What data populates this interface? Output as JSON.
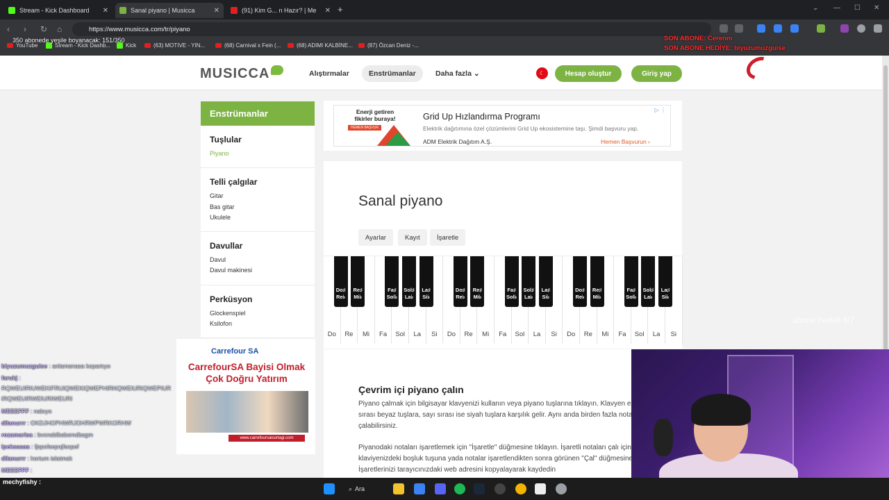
{
  "tabs": [
    {
      "title": "Stream - Kick Dashboard",
      "color": "#53fc18"
    },
    {
      "title": "Sanal piyano | Musicca",
      "color": "#7cb342"
    },
    {
      "title": "(91) Kim G... n Hazır? | Me",
      "color": "#e02020"
    }
  ],
  "address": {
    "url": "https://www.musicca.com/tr/piyano"
  },
  "bookmarks": [
    "YouTube",
    "Stream - Kick Dashb...",
    "Kick",
    "(63) MOTIVE - YIN...",
    "(68) Carnival x Fein (...",
    "(68) ADIMI KALBİNE...",
    "(87) Özcan Deniz -..."
  ],
  "overlay": {
    "subs": "350 abonede yeşile boyanacak: 151/350",
    "last_sub": "SON ABONE: Cerenm",
    "last_gift": "SON ABONE HEDİYE: biyuzumuzguise",
    "goal": "abone hedefi 6/7"
  },
  "site": {
    "logo": "MUSICCA",
    "nav": [
      "Alıştırmalar",
      "Enstrümanlar",
      "Daha fazla"
    ],
    "signup": "Hesap oluştur",
    "login": "Giriş yap"
  },
  "sidebar": {
    "title": "Enstrümanlar",
    "sections": [
      {
        "heading": "Tuşlular",
        "items": [
          "Piyano"
        ]
      },
      {
        "heading": "Telli çalgılar",
        "items": [
          "Gitar",
          "Bas gitar",
          "Ukulele"
        ]
      },
      {
        "heading": "Davullar",
        "items": [
          "Davul",
          "Davul makinesi"
        ]
      },
      {
        "heading": "Perküsyon",
        "items": [
          "Glockenspiel",
          "Ksilofon"
        ]
      }
    ]
  },
  "ad": {
    "img_text": "Enerji getiren fikirler buraya!",
    "img_button": "HEMEN BAŞVUR",
    "title": "Grid Up Hızlandırma Programı",
    "desc": "Elektrik dağıtımına özel çözümlerini Grid Up ekosistemine taşı. Şimdi başvuru yap.",
    "advertiser": "ADM Elektrik Dağıtım A.Ş.",
    "cta": "Hemen Başvurun ›"
  },
  "main": {
    "title": "Sanal piyano",
    "tools": [
      "Ayarlar",
      "Kayıt",
      "İşaretle"
    ],
    "white_keys": [
      "Do",
      "Re",
      "Mi",
      "Fa",
      "Sol",
      "La",
      "Si",
      "Do",
      "Re",
      "Mi",
      "Fa",
      "Sol",
      "La",
      "Si",
      "Do",
      "Re",
      "Mi",
      "Fa",
      "Sol",
      "La",
      "Si"
    ],
    "black_keys": [
      "Do♯ Re♭",
      "Re♯ Mi♭",
      "Fa♯ Sol♭",
      "Sol♯ La♭",
      "La♯ Si♭",
      "Do♯ Re♭",
      "Re♯ Mi♭",
      "Fa♯ Sol♭",
      "Sol♯ La♭",
      "La♯ Si♭",
      "Do♯ Re♭",
      "Re♯ Mi♭",
      "Fa♯ Sol♭",
      "Sol♯ La♭",
      "La♯ Si♭"
    ],
    "section_title": "Çevrim içi piyano çalın",
    "p1": "Piyano çalmak için bilgisayar klavyenizi kullanın veya piyano tuşlarına tıklayın. Klavyen en üstteki harf sırası beyaz tuşlara, sayı sırası ise siyah tuşlara karşılık gelir. Aynı anda birden fazla nota çalabilirsiniz.",
    "p2": "Piyanodaki notaları işaretlemek için \"İşaretle\" düğmesine tıklayın. İşaretli notaları çalı için klaviyenizdeki boşluk tuşuna yada notalar işaretlendikten sonra görünen \"Çal\" düğmesine tıklayın. İşaretlerinizi tarayıcınızdaki web adresini kopyalayarak kaydedin"
  },
  "side_ad": {
    "brand": "Carrefour SA",
    "headline": "CarrefourSA Bayisi Olmak Çok Doğru Yatırım",
    "url": "www.carrefoursaisortagi.com"
  },
  "chat": [
    {
      "name": "biyuzumuzguise",
      "msg": ": anlamanasa kopartıyo"
    },
    {
      "name": "farukj",
      "msg": ":"
    },
    {
      "name": "",
      "msg": "RQWEUIRIUWEKIFRUIQWEKIQWEPHIRNQWEIURIQWEPIUR"
    },
    {
      "name": "",
      "msg": "IRQWEUIRWEIURIWEURI"
    },
    {
      "name": "MEEEFFF",
      "msg": ": nabıyo"
    },
    {
      "name": "dilanurrr",
      "msg": ": OKDJHOPHWRJOHRWPWRKORHW"
    },
    {
      "name": "rozamarisa",
      "msg": ": bvcnsbfbsbsmdbsgm"
    },
    {
      "name": "lpeksaaaa",
      "msg": ": fjspofsepojfsopef"
    },
    {
      "name": "dilanurrr",
      "msg": ": hortum islatmak"
    },
    {
      "name": "MEEEFFF",
      "msg": ":"
    }
  ],
  "chat_last": "mechyfishy :",
  "taskbar": {
    "search": "Ara"
  }
}
